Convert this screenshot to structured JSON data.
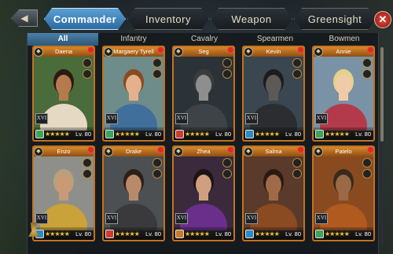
{
  "nav": {
    "back_icon": "back-arrow-icon",
    "close_icon": "close-icon",
    "tabs": [
      "Commander",
      "Inventory",
      "Weapon",
      "Greensight"
    ],
    "active_tab": "Commander"
  },
  "categories": [
    "All",
    "Infantry",
    "Cavalry",
    "Spearmen",
    "Bowmen"
  ],
  "active_category": "All",
  "commanders": [
    {
      "name": "Daena",
      "tier": "XVI",
      "stars": "★★★★★",
      "level": "Lv. 80",
      "troop_color": "#3aa655",
      "skin": "#b57a4e",
      "hair": "#2b1a12",
      "cloth": "#e6d9c4",
      "bg": "#4a6b3a"
    },
    {
      "name": "Margaery Tyrell",
      "tier": "XVI",
      "stars": "★★★★★",
      "level": "Lv. 80",
      "troop_color": "#3aa655",
      "skin": "#e3b28d",
      "hair": "#8a4a20",
      "cloth": "#3f6f9a",
      "bg": "#6e8c8a"
    },
    {
      "name": "Seg",
      "tier": "XVI",
      "stars": "★★★★★",
      "level": "Lv. 80",
      "troop_color": "#d13b2d",
      "skin": "#8c8f8d",
      "hair": "#3b3b3b",
      "cloth": "#3e4347",
      "bg": "#2c3338"
    },
    {
      "name": "Kevin",
      "tier": "XVI",
      "stars": "★★★★★",
      "level": "Lv. 80",
      "troop_color": "#2a8cc4",
      "skin": "#5d5a55",
      "hair": "#1b1c1e",
      "cloth": "#2b2d30",
      "bg": "#3a4650"
    },
    {
      "name": "Annie",
      "tier": "XVI",
      "stars": "★★★★★",
      "level": "Lv. 80",
      "troop_color": "#3aa655",
      "skin": "#f0cba8",
      "hair": "#e5d28a",
      "cloth": "#b33a4a",
      "bg": "#7a92a6"
    },
    {
      "name": "Enzo",
      "tier": "XVI",
      "stars": "★★★★★",
      "level": "Lv. 80",
      "troop_color": "#2a8cc4",
      "skin": "#c89a76",
      "hair": "#b8a07a",
      "cloth": "#c9a23a",
      "bg": "#8e8f8a"
    },
    {
      "name": "Drake",
      "tier": "XVI",
      "stars": "★★★★★",
      "level": "Lv. 80",
      "troop_color": "#d13b2d",
      "skin": "#b98a6a",
      "hair": "#2a2018",
      "cloth": "#3a3a3c",
      "bg": "#4c5053"
    },
    {
      "name": "Zhea",
      "tier": "XVI",
      "stars": "★★★★★",
      "level": "Lv. 80",
      "troop_color": "#c97a2a",
      "skin": "#cfa080",
      "hair": "#1f1214",
      "cloth": "#6a2f8a",
      "bg": "#3a2a3c"
    },
    {
      "name": "Salma",
      "tier": "XVI",
      "stars": "★★★★★",
      "level": "Lv. 80",
      "troop_color": "#2a8cc4",
      "skin": "#a06a48",
      "hair": "#2a1a12",
      "cloth": "#8a4a22",
      "bg": "#5a3a2a"
    },
    {
      "name": "Patelo",
      "tier": "XVI",
      "stars": "★★★★★",
      "level": "Lv. 80",
      "troop_color": "#3aa655",
      "skin": "#9a6a48",
      "hair": "#3a2a1a",
      "cloth": "#b05a20",
      "bg": "#8a4a20"
    }
  ]
}
